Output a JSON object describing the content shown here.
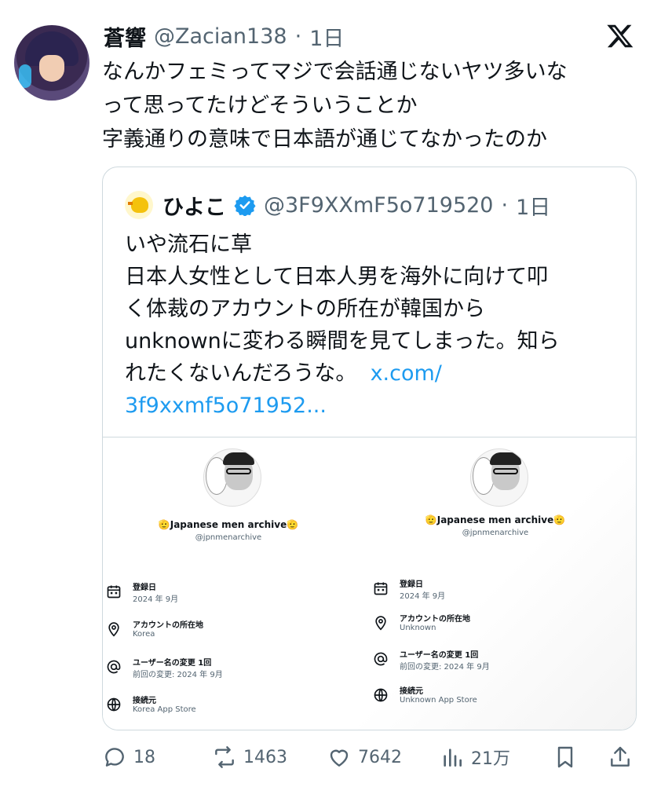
{
  "tweet": {
    "author_name": "蒼響",
    "handle": "@Zacian138",
    "separator": "·",
    "time": "1日",
    "lines": [
      "なんかフェミってマジで会話通じないヤツ多いな",
      "って思ってたけどそういうことか",
      "字義通りの意味で日本語が通じてなかったのか"
    ]
  },
  "quote": {
    "author_name": "ひよこ",
    "handle": "@3F9XXmF5o719520",
    "separator": "·",
    "time": "1日",
    "lines": [
      "いや流石に草",
      "日本人女性として日本人男を海外に向けて叩",
      "く体裁のアカウントの所在が韓国から",
      "unknownに変わる瞬間を見てしまった。知ら",
      "れたくないんだろうな。"
    ],
    "link_part1": "x.com/",
    "link_part2": "3f9xxmf5o71952..."
  },
  "screenshot": {
    "left": {
      "name": "🫡Japanese men archive🫡",
      "handle": "@jpnmenarchive",
      "rows": [
        {
          "title": "登録日",
          "value": "2024 年 9月"
        },
        {
          "title": "アカウントの所在地",
          "value": "Korea"
        },
        {
          "title": "ユーザー名の変更 1回",
          "value": "前回の変更: 2024 年 9月"
        },
        {
          "title": "接続元",
          "value": "Korea App Store"
        }
      ]
    },
    "right": {
      "name": "🫡Japanese men archive🫡",
      "handle": "@jpnmenarchive",
      "rows": [
        {
          "title": "登録日",
          "value": "2024 年 9月"
        },
        {
          "title": "アカウントの所在地",
          "value": "Unknown"
        },
        {
          "title": "ユーザー名の変更 1回",
          "value": "前回の変更: 2024 年 9月"
        },
        {
          "title": "接続元",
          "value": "Unknown App Store"
        }
      ]
    }
  },
  "actions": {
    "replies": "18",
    "reposts": "1463",
    "likes": "7642",
    "views": "21万"
  },
  "icons": [
    "x-logo-icon",
    "verified-badge-icon",
    "calendar-icon",
    "location-pin-icon",
    "at-sign-icon",
    "globe-icon",
    "reply-icon",
    "repost-icon",
    "like-icon",
    "views-icon",
    "bookmark-icon",
    "share-icon"
  ],
  "colors": {
    "link": "#1d9bf0",
    "secondary_text": "#536471",
    "verified": "#1d9bf0"
  }
}
